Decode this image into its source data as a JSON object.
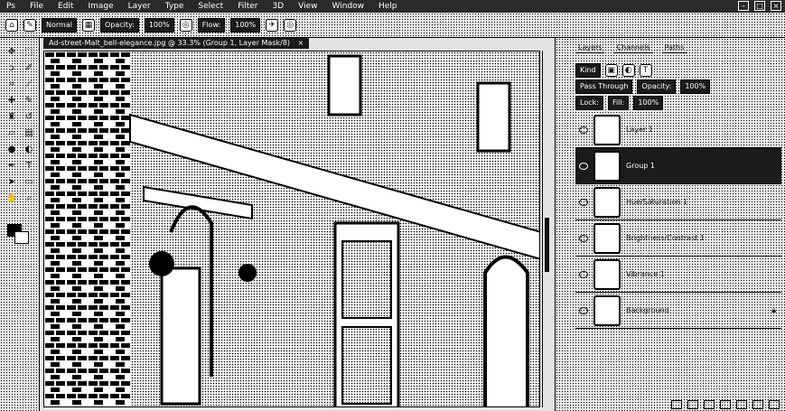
{
  "menubar": {
    "items": [
      "Ps",
      "File",
      "Edit",
      "Image",
      "Layer",
      "Type",
      "Select",
      "Filter",
      "3D",
      "View",
      "Window",
      "Help"
    ]
  },
  "options": {
    "mode_label": "Normal",
    "opacity_label": "Opacity:",
    "opacity_value": "100%",
    "flow_label": "Flow:",
    "flow_value": "100%"
  },
  "document": {
    "tab_label": "Ad-street-Malt_bell-elegance.jpg @ 33.3% (Group 1, Layer Mask/8)"
  },
  "panel": {
    "tabs": [
      "Layers",
      "Channels",
      "Paths"
    ],
    "kind_label": "Kind",
    "blend_label": "Pass Through",
    "opacity_label": "Opacity:",
    "opacity_value": "100%",
    "lock_label": "Lock:",
    "fill_label": "Fill:",
    "fill_value": "100%",
    "layers": [
      {
        "name": "Layer 1"
      },
      {
        "name": "Group 1"
      },
      {
        "name": "Hue/Saturation 1"
      },
      {
        "name": "Brightness/Contrast 1"
      },
      {
        "name": "Vibrance 1"
      },
      {
        "name": "Background"
      }
    ]
  },
  "icons": {
    "tools": [
      "move-icon",
      "marquee-icon",
      "lasso-icon",
      "quick-select-icon",
      "crop-icon",
      "eyedropper-icon",
      "healing-icon",
      "brush-icon",
      "stamp-icon",
      "history-brush-icon",
      "eraser-icon",
      "gradient-icon",
      "blur-icon",
      "dodge-icon",
      "pen-icon",
      "type-icon",
      "path-select-icon",
      "shape-icon",
      "hand-icon",
      "zoom-icon"
    ]
  }
}
